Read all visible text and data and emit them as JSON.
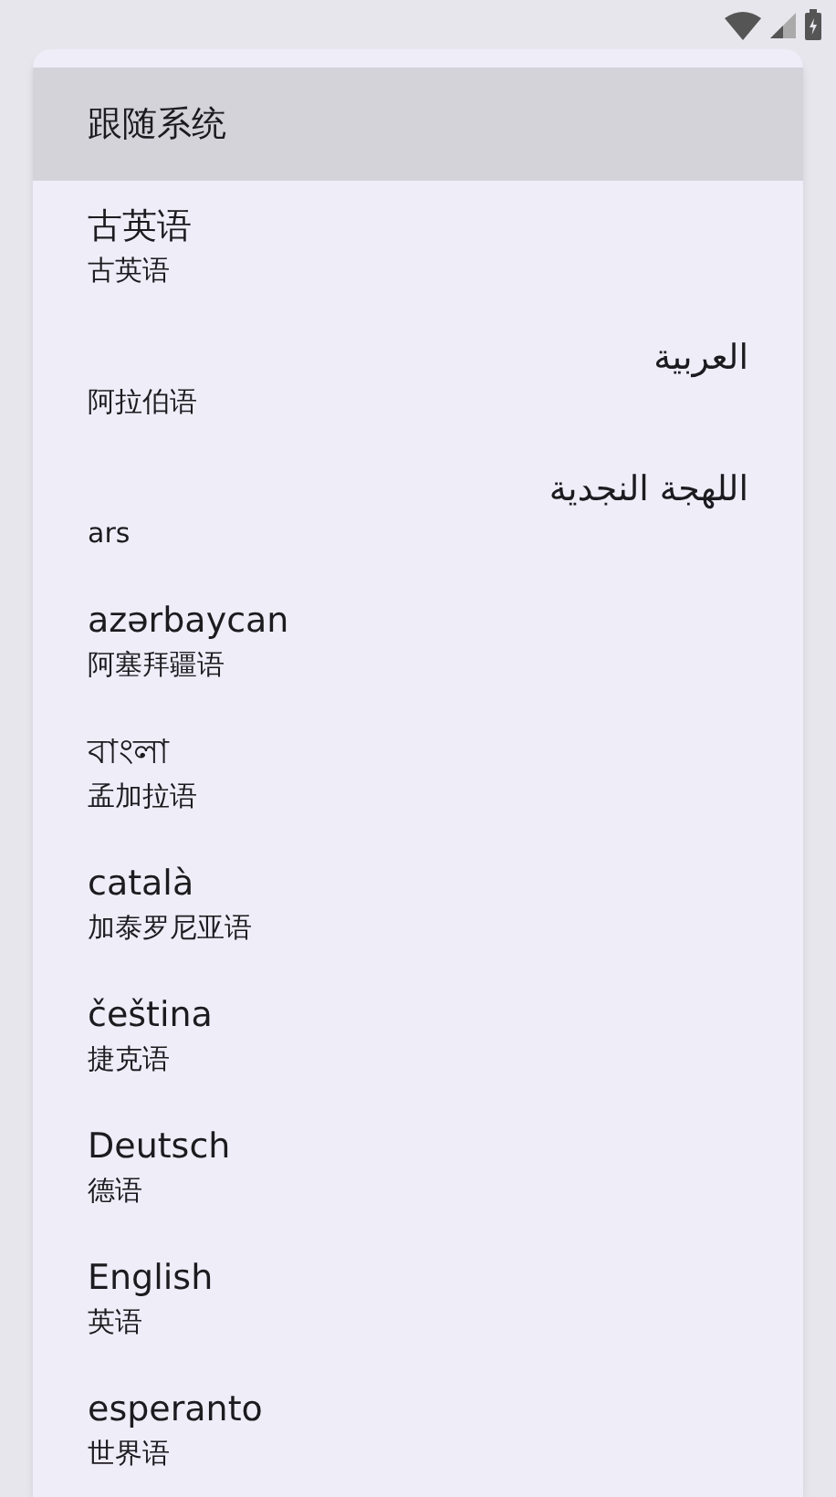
{
  "dialog": {
    "options": [
      {
        "kind": "single",
        "title": "跟随系统",
        "selected": true
      },
      {
        "kind": "ltr",
        "title": "古英语",
        "subtitle": "古英语",
        "selected": false
      },
      {
        "kind": "rtl",
        "title": "العربية",
        "subtitle": "阿拉伯语",
        "selected": false
      },
      {
        "kind": "rtl",
        "title": "اللهجة النجدية",
        "subtitle": "ars",
        "selected": false
      },
      {
        "kind": "ltr",
        "title": "azərbaycan",
        "subtitle": "阿塞拜疆语",
        "selected": false
      },
      {
        "kind": "ltr",
        "title": "বাংলা",
        "subtitle": "孟加拉语",
        "selected": false
      },
      {
        "kind": "ltr",
        "title": "català",
        "subtitle": "加泰罗尼亚语",
        "selected": false
      },
      {
        "kind": "ltr",
        "title": "čeština",
        "subtitle": "捷克语",
        "selected": false
      },
      {
        "kind": "ltr",
        "title": "Deutsch",
        "subtitle": "德语",
        "selected": false
      },
      {
        "kind": "ltr",
        "title": "English",
        "subtitle": "英语",
        "selected": false
      },
      {
        "kind": "ltr",
        "title": "esperanto",
        "subtitle": "世界语",
        "selected": false
      }
    ]
  }
}
